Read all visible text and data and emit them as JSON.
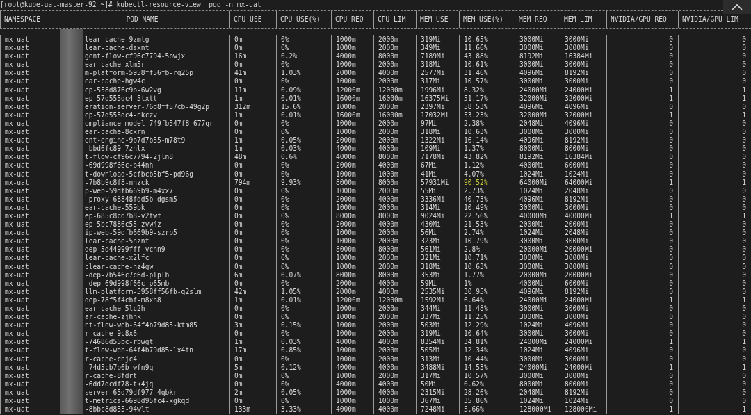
{
  "terminal": {
    "command_line": "[root@kube-uat-master-92 ~]# kubectl-resource-view  pod -n mx-uat"
  },
  "table": {
    "columns": [
      "NAMESPACE",
      "POD NAME",
      "CPU USE",
      "CPU USE(%)",
      "CPU REQ",
      "CPU LIM",
      "MEM USE",
      "MEM USE(%)",
      "MEM REQ",
      "MEM LIM",
      "NVIDIA/GPU REQ",
      "NVIDIA/GPU LIM"
    ],
    "rows": [
      {
        "cells": [
          "mx-uat",
          "lear-cache-9zmtg",
          "0m",
          "0%",
          "1000m",
          "2000m",
          "319Mi",
          "10.65%",
          "3000Mi",
          "3000Mi",
          "0",
          "0"
        ],
        "mem_alert": false
      },
      {
        "cells": [
          "mx-uat",
          "lear-cache-dsxnt",
          "0m",
          "0%",
          "1000m",
          "2000m",
          "349Mi",
          "11.66%",
          "3000Mi",
          "3000Mi",
          "0",
          "0"
        ],
        "mem_alert": false
      },
      {
        "cells": [
          "mx-uat",
          "gent-flow-cf96c7794-5bwjx",
          "16m",
          "0.2%",
          "4000m",
          "8000m",
          "7189Mi",
          "43.88%",
          "8192Mi",
          "16384Mi",
          "0",
          "0"
        ],
        "mem_alert": false
      },
      {
        "cells": [
          "mx-uat",
          "ear-cache-xlm5r",
          "0m",
          "0%",
          "1000m",
          "2000m",
          "318Mi",
          "10.61%",
          "3000Mi",
          "3000Mi",
          "0",
          "0"
        ],
        "mem_alert": false
      },
      {
        "cells": [
          "mx-uat",
          "m-platform-5958ff56fb-rq25p",
          "41m",
          "1.03%",
          "2000m",
          "4000m",
          "2577Mi",
          "31.46%",
          "4096Mi",
          "8192Mi",
          "0",
          "0"
        ],
        "mem_alert": false
      },
      {
        "cells": [
          "mx-uat",
          "ear-cache-hgw4c",
          "0m",
          "0%",
          "1000m",
          "2000m",
          "317Mi",
          "10.57%",
          "3000Mi",
          "3000Mi",
          "0",
          "0"
        ],
        "mem_alert": false
      },
      {
        "cells": [
          "mx-uat",
          "ep-558d876c9b-6w2vg",
          "11m",
          "0.09%",
          "12000m",
          "12000m",
          "1996Mi",
          "8.32%",
          "24000Mi",
          "24000Mi",
          "1",
          "1"
        ],
        "mem_alert": false
      },
      {
        "cells": [
          "mx-uat",
          "ep-57d555dc4-5txtt",
          "1m",
          "0.01%",
          "16000m",
          "16000m",
          "16375Mi",
          "51.17%",
          "32000Mi",
          "32000Mi",
          "1",
          "1"
        ],
        "mem_alert": false
      },
      {
        "cells": [
          "mx-uat",
          "eration-server-76d8ff57cb-49g2p",
          "312m",
          "15.6%",
          "1000m",
          "2000m",
          "2397Mi",
          "58.53%",
          "4096Mi",
          "4096Mi",
          "0",
          "0"
        ],
        "mem_alert": false
      },
      {
        "cells": [
          "mx-uat",
          "ep-57d555dc4-nkczv",
          "1m",
          "0.01%",
          "16000m",
          "16000m",
          "17032Mi",
          "53.23%",
          "32000Mi",
          "32000Mi",
          "1",
          "1"
        ],
        "mem_alert": false
      },
      {
        "cells": [
          "mx-uat",
          "ompliance-model-749fb547f8-677qr",
          "0m",
          "0%",
          "1000m",
          "2000m",
          "97Mi",
          "2.38%",
          "2048Mi",
          "4096Mi",
          "0",
          "0"
        ],
        "mem_alert": false
      },
      {
        "cells": [
          "mx-uat",
          "ear-cache-8cxrn",
          "0m",
          "0%",
          "1000m",
          "2000m",
          "318Mi",
          "10.63%",
          "3000Mi",
          "3000Mi",
          "0",
          "0"
        ],
        "mem_alert": false
      },
      {
        "cells": [
          "mx-uat",
          "ent-engine-9b7d7b55-m78t9",
          "1m",
          "0.05%",
          "2000m",
          "2000m",
          "1322Mi",
          "16.14%",
          "4096Mi",
          "8192Mi",
          "0",
          "0"
        ],
        "mem_alert": false
      },
      {
        "cells": [
          "mx-uat",
          "-bbd6fc89-7znlx",
          "1m",
          "0.03%",
          "4000m",
          "4000m",
          "109Mi",
          "1.37%",
          "8000Mi",
          "8000Mi",
          "0",
          "0"
        ],
        "mem_alert": false
      },
      {
        "cells": [
          "mx-uat",
          "t-flow-cf96c7794-2jln8",
          "48m",
          "0.6%",
          "4000m",
          "8000m",
          "7178Mi",
          "43.82%",
          "8192Mi",
          "16384Mi",
          "0",
          "0"
        ],
        "mem_alert": false
      },
      {
        "cells": [
          "mx-uat",
          "-69d998f66c-b44nh",
          "0m",
          "0%",
          "2000m",
          "4000m",
          "67Mi",
          "1.12%",
          "4000Mi",
          "6000Mi",
          "0",
          "0"
        ],
        "mem_alert": false
      },
      {
        "cells": [
          "mx-uat",
          "t-download-5cfbcb5bf5-pd96g",
          "0m",
          "0%",
          "1000m",
          "1000m",
          "41Mi",
          "4.07%",
          "1024Mi",
          "1024Mi",
          "0",
          "0"
        ],
        "mem_alert": false
      },
      {
        "cells": [
          "mx-uat",
          "-7b8b9c8f8-nhzck",
          "794m",
          "9.93%",
          "8000m",
          "8000m",
          "57931Mi",
          "90.52%",
          "64000Mi",
          "64000Mi",
          "1",
          "1"
        ],
        "mem_alert": true
      },
      {
        "cells": [
          "mx-uat",
          "p-web-59dfb669b9-m4xx7",
          "0m",
          "0%",
          "1000m",
          "2000m",
          "55Mi",
          "2.73%",
          "1024Mi",
          "2048Mi",
          "0",
          "0"
        ],
        "mem_alert": false
      },
      {
        "cells": [
          "mx-uat",
          "-proxy-68848fdd5b-dgsm5",
          "0m",
          "0%",
          "2000m",
          "4000m",
          "3336Mi",
          "40.73%",
          "4096Mi",
          "8192Mi",
          "0",
          "0"
        ],
        "mem_alert": false
      },
      {
        "cells": [
          "mx-uat",
          "ear-cache-559bk",
          "0m",
          "0%",
          "1000m",
          "2000m",
          "314Mi",
          "10.49%",
          "3000Mi",
          "3000Mi",
          "0",
          "0"
        ],
        "mem_alert": false
      },
      {
        "cells": [
          "mx-uat",
          "ep-685c8cd7b8-v2twf",
          "0m",
          "0%",
          "8000m",
          "8000m",
          "9024Mi",
          "22.56%",
          "40000Mi",
          "40000Mi",
          "1",
          "1"
        ],
        "mem_alert": false
      },
      {
        "cells": [
          "mx-uat",
          "ep-5bc7886c55-zvw4z",
          "0m",
          "0%",
          "2000m",
          "4000m",
          "430Mi",
          "21.53%",
          "2000Mi",
          "2000Mi",
          "0",
          "0"
        ],
        "mem_alert": false
      },
      {
        "cells": [
          "mx-uat",
          "ip-web-59dfb669b9-szrb5",
          "0m",
          "0%",
          "1000m",
          "2000m",
          "56Mi",
          "2.74%",
          "1024Mi",
          "2048Mi",
          "0",
          "0"
        ],
        "mem_alert": false
      },
      {
        "cells": [
          "mx-uat",
          "lear-cache-5nznt",
          "0m",
          "0%",
          "1000m",
          "2000m",
          "323Mi",
          "10.79%",
          "3000Mi",
          "3000Mi",
          "0",
          "0"
        ],
        "mem_alert": false
      },
      {
        "cells": [
          "mx-uat",
          "dep-5d44999fff-vchn9",
          "0m",
          "0%",
          "8000m",
          "8000m",
          "561Mi",
          "2.8%",
          "20000Mi",
          "20000Mi",
          "0",
          "0"
        ],
        "mem_alert": false
      },
      {
        "cells": [
          "mx-uat",
          "lear-cache-x2lfc",
          "0m",
          "0%",
          "1000m",
          "2000m",
          "321Mi",
          "10.71%",
          "3000Mi",
          "3000Mi",
          "0",
          "0"
        ],
        "mem_alert": false
      },
      {
        "cells": [
          "mx-uat",
          "clear-cache-hz4gw",
          "0m",
          "0%",
          "1000m",
          "2000m",
          "318Mi",
          "10.63%",
          "3000Mi",
          "3000Mi",
          "0",
          "0"
        ],
        "mem_alert": false
      },
      {
        "cells": [
          "mx-uat",
          "-dep-7b546c7c6d-plplb",
          "6m",
          "0.07%",
          "8000m",
          "8000m",
          "353Mi",
          "1.77%",
          "20000Mi",
          "20000Mi",
          "0",
          "0"
        ],
        "mem_alert": false
      },
      {
        "cells": [
          "mx-uat",
          "-dep-69d998f66c-p65mb",
          "0m",
          "0%",
          "2000m",
          "4000m",
          "59Mi",
          "1%",
          "4000Mi",
          "6000Mi",
          "0",
          "0"
        ],
        "mem_alert": false
      },
      {
        "cells": [
          "mx-uat",
          "llm-platform-5958ff56fb-q2slm",
          "42m",
          "1.05%",
          "2000m",
          "4000m",
          "2535Mi",
          "30.95%",
          "4096Mi",
          "8192Mi",
          "0",
          "0"
        ],
        "mem_alert": false
      },
      {
        "cells": [
          "mx-uat",
          "dep-78f5f4cbf-m8xh8",
          "1m",
          "0.01%",
          "12000m",
          "12000m",
          "1592Mi",
          "6.64%",
          "24000Mi",
          "24000Mi",
          "1",
          "1"
        ],
        "mem_alert": false
      },
      {
        "cells": [
          "mx-uat",
          "ear-cache-5lc2h",
          "0m",
          "0%",
          "1000m",
          "2000m",
          "344Mi",
          "11.48%",
          "3000Mi",
          "3000Mi",
          "0",
          "0"
        ],
        "mem_alert": false
      },
      {
        "cells": [
          "mx-uat",
          "ar-cache-zjhnk",
          "0m",
          "0%",
          "1000m",
          "2000m",
          "337Mi",
          "11.25%",
          "3000Mi",
          "3000Mi",
          "0",
          "0"
        ],
        "mem_alert": false
      },
      {
        "cells": [
          "mx-uat",
          "nt-flow-web-64f4b79d85-ktm85",
          "3m",
          "0.15%",
          "1000m",
          "2000m",
          "503Mi",
          "12.29%",
          "1024Mi",
          "4096Mi",
          "0",
          "0"
        ],
        "mem_alert": false
      },
      {
        "cells": [
          "mx-uat",
          "r-cache-9c8x6",
          "0m",
          "0%",
          "1000m",
          "2000m",
          "319Mi",
          "10.64%",
          "3000Mi",
          "3000Mi",
          "0",
          "0"
        ],
        "mem_alert": false
      },
      {
        "cells": [
          "mx-uat",
          "-74686d55bc-rbwgt",
          "1m",
          "0.03%",
          "4000m",
          "4000m",
          "8354Mi",
          "34.81%",
          "24000Mi",
          "24000Mi",
          "1",
          "1"
        ],
        "mem_alert": false
      },
      {
        "cells": [
          "mx-uat",
          "t-flow-web-64f4b79d85-lx4tn",
          "17m",
          "0.85%",
          "1000m",
          "2000m",
          "505Mi",
          "12.34%",
          "1024Mi",
          "4096Mi",
          "0",
          "0"
        ],
        "mem_alert": false
      },
      {
        "cells": [
          "mx-uat",
          "r-cache-chjc4",
          "0m",
          "0%",
          "1000m",
          "2000m",
          "313Mi",
          "10.44%",
          "3000Mi",
          "3000Mi",
          "0",
          "0"
        ],
        "mem_alert": false
      },
      {
        "cells": [
          "mx-uat",
          "-74d5cb7b6b-wfn9q",
          "5m",
          "0.12%",
          "4000m",
          "4000m",
          "3488Mi",
          "14.53%",
          "24000Mi",
          "24000Mi",
          "1",
          "1"
        ],
        "mem_alert": false
      },
      {
        "cells": [
          "mx-uat",
          "r-cache-8fdrt",
          "0m",
          "0%",
          "1000m",
          "2000m",
          "317Mi",
          "10.57%",
          "3000Mi",
          "3000Mi",
          "0",
          "0"
        ],
        "mem_alert": false
      },
      {
        "cells": [
          "mx-uat",
          "-6dd7dcdf78-tk4jq",
          "0m",
          "0%",
          "4000m",
          "4000m",
          "50Mi",
          "0.62%",
          "8000Mi",
          "8000Mi",
          "0",
          "0"
        ],
        "mem_alert": false
      },
      {
        "cells": [
          "mx-uat",
          "server-65d79df977-4qbkr",
          "2m",
          "0.05%",
          "1000m",
          "4000m",
          "2315Mi",
          "28.26%",
          "2048Mi",
          "8192Mi",
          "0",
          "0"
        ],
        "mem_alert": false
      },
      {
        "cells": [
          "mx-uat",
          "t-metrics-6698d95fc4-xgkqd",
          "0m",
          "0%",
          "1000m",
          "1000m",
          "367Mi",
          "35.86%",
          "1024Mi",
          "1024Mi",
          "0",
          "0"
        ],
        "mem_alert": false
      },
      {
        "cells": [
          "mx-uat",
          "-8bbc8d855-94wlt",
          "133m",
          "3.33%",
          "4000m",
          "4000m",
          "7248Mi",
          "5.66%",
          "128000Mi",
          "128000Mi",
          "1",
          "1"
        ],
        "mem_alert": false
      }
    ]
  }
}
